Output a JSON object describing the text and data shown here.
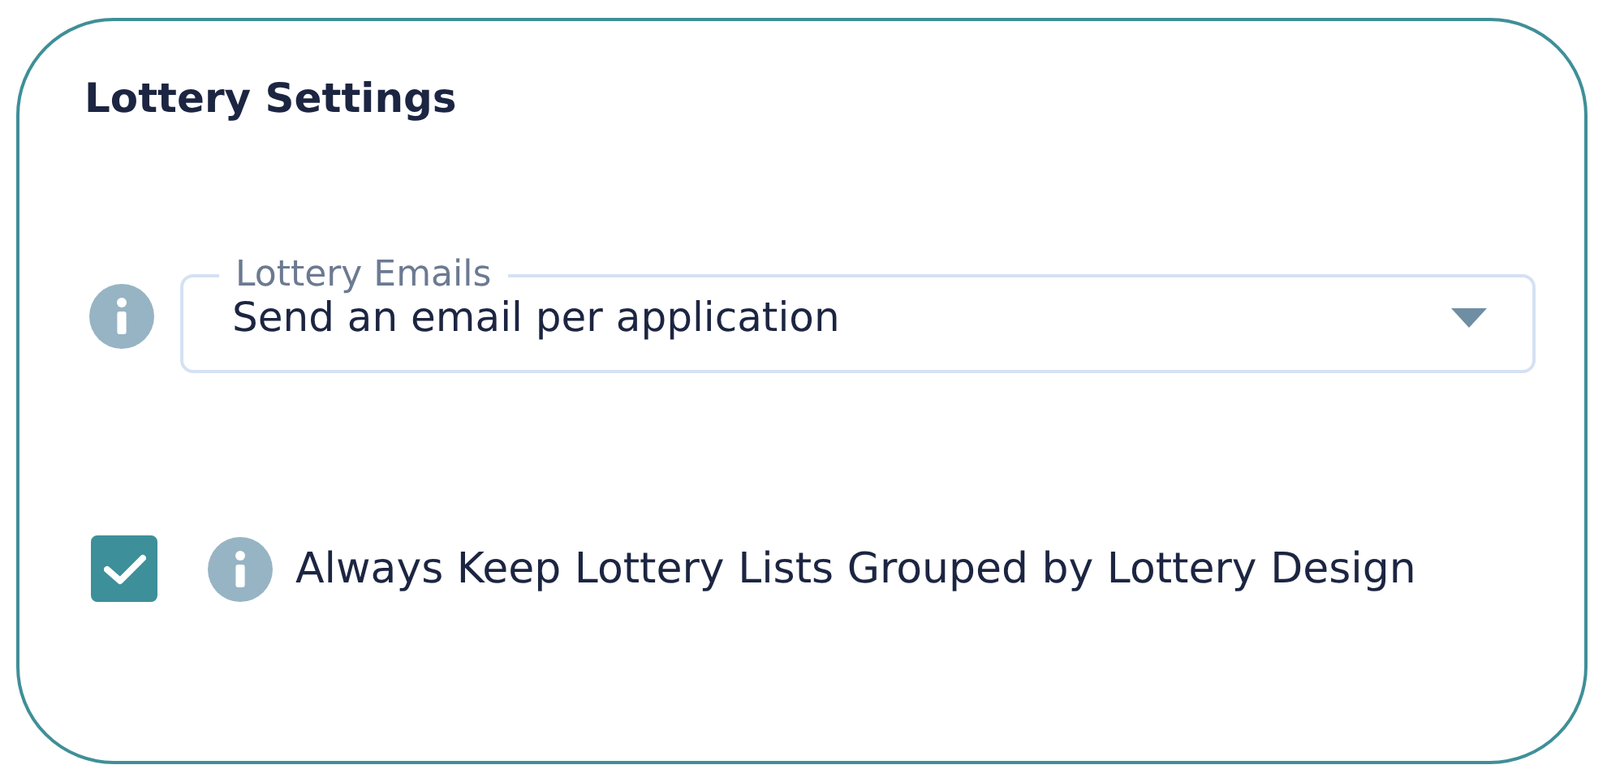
{
  "section": {
    "title": "Lottery Settings"
  },
  "email_select": {
    "label": "Lottery Emails",
    "value": "Send an email per application"
  },
  "group_option": {
    "label": "Always Keep Lottery Lists Grouped by Lottery Design",
    "checked": true
  }
}
